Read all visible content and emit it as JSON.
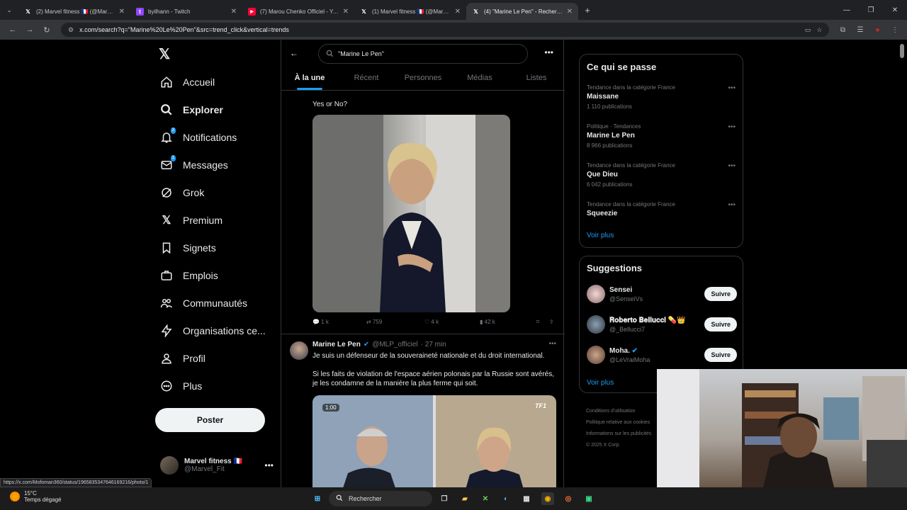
{
  "browser": {
    "tabs": [
      {
        "title": "(2) Marvel fitness 🇫🇷 (@Marvel_F",
        "favicon": "X"
      },
      {
        "title": "byilhann - Twitch",
        "favicon": "twitch"
      },
      {
        "title": "(7) Marou Chenko Officiel - You",
        "favicon": "youtube"
      },
      {
        "title": "(1) Marvel fitness 🇫🇷 (@Marvel_F",
        "favicon": "X"
      },
      {
        "title": "(4) \"Marine Le Pen\" - Recherche",
        "favicon": "X"
      }
    ],
    "new_tab": "+",
    "url": "x.com/search?q=\"Marine%20Le%20Pen\"&src=trend_click&vertical=trends"
  },
  "nav": {
    "items": [
      {
        "label": "Accueil",
        "icon": "home-icon"
      },
      {
        "label": "Explorer",
        "icon": "search-icon"
      },
      {
        "label": "Notifications",
        "icon": "bell-icon",
        "badge": "3"
      },
      {
        "label": "Messages",
        "icon": "mail-icon",
        "badge": "1"
      },
      {
        "label": "Grok",
        "icon": "grok-icon"
      },
      {
        "label": "Premium",
        "icon": "x-logo-icon"
      },
      {
        "label": "Signets",
        "icon": "bookmark-icon"
      },
      {
        "label": "Emplois",
        "icon": "briefcase-icon"
      },
      {
        "label": "Communautés",
        "icon": "people-icon"
      },
      {
        "label": "Organisations ce...",
        "icon": "lightning-icon"
      },
      {
        "label": "Profil",
        "icon": "person-icon"
      },
      {
        "label": "Plus",
        "icon": "more-circle-icon"
      }
    ],
    "post_button": "Poster",
    "account": {
      "name": "Marvel fitness 🇫🇷",
      "handle": "@Marvel_Fit"
    }
  },
  "search": {
    "query": "\"Marine Le Pen\""
  },
  "tabs": [
    "À la une",
    "Récent",
    "Personnes",
    "Médias",
    "Listes"
  ],
  "tweet1": {
    "text": "Yes or No?",
    "replies": "1 k",
    "reposts": "759",
    "likes": "4 k",
    "views": "42 k"
  },
  "tweet2": {
    "name": "Marine Le Pen",
    "handle": "@MLP_officiel",
    "time": "· 27 min",
    "line1": "Je suis un défenseur de la souveraineté nationale et du droit international.",
    "line2": "Si les faits de violation de l'espace aérien polonais par la Russie sont avérés, je les condamne de la manière la plus ferme qui soit.",
    "video_time": "1:00",
    "video_logo": "TF1"
  },
  "trends": {
    "title": "Ce qui se passe",
    "items": [
      {
        "category": "Tendance dans la catégorie France",
        "name": "Maissane",
        "count": "1 110 publications"
      },
      {
        "category": "Politique · Tendances",
        "name": "Marine Le Pen",
        "count": "8 966 publications"
      },
      {
        "category": "Tendance dans la catégorie France",
        "name": "Que Dieu",
        "count": "6 042 publications"
      },
      {
        "category": "Tendance dans la catégorie France",
        "name": "Squeezie",
        "count": ""
      }
    ],
    "more": "Voir plus"
  },
  "suggestions": {
    "title": "Suggestions",
    "items": [
      {
        "name": "Sensei",
        "handle": "@SenseiVs",
        "button": "Suivre"
      },
      {
        "name": "𝐑𝐨𝐛𝐞𝐫𝐭𝐨 𝐁𝐞𝐥𝐥𝐮𝐜𝐜𝐢 💊👑",
        "handle": "@_Bellucci7",
        "button": "Suivre"
      },
      {
        "name": "Moha.",
        "handle": "@LeVraiMoha",
        "button": "Suivre"
      }
    ],
    "more": "Voir plus"
  },
  "footer": {
    "line1": "Conditions d'utilisation",
    "line2": "Politique relative aux cookies",
    "line3": "Informations sur les publicités",
    "line4": "© 2025 X Corp."
  },
  "status_url": "https://x.com/Mofoman360/status/1965835347646169216/photo/1",
  "taskbar": {
    "temp": "15°C",
    "weather": "Temps dégagé",
    "search": "Rechercher"
  },
  "colors": {
    "accent": "#1d9bf0",
    "background": "#000000",
    "border": "#2f3336"
  }
}
